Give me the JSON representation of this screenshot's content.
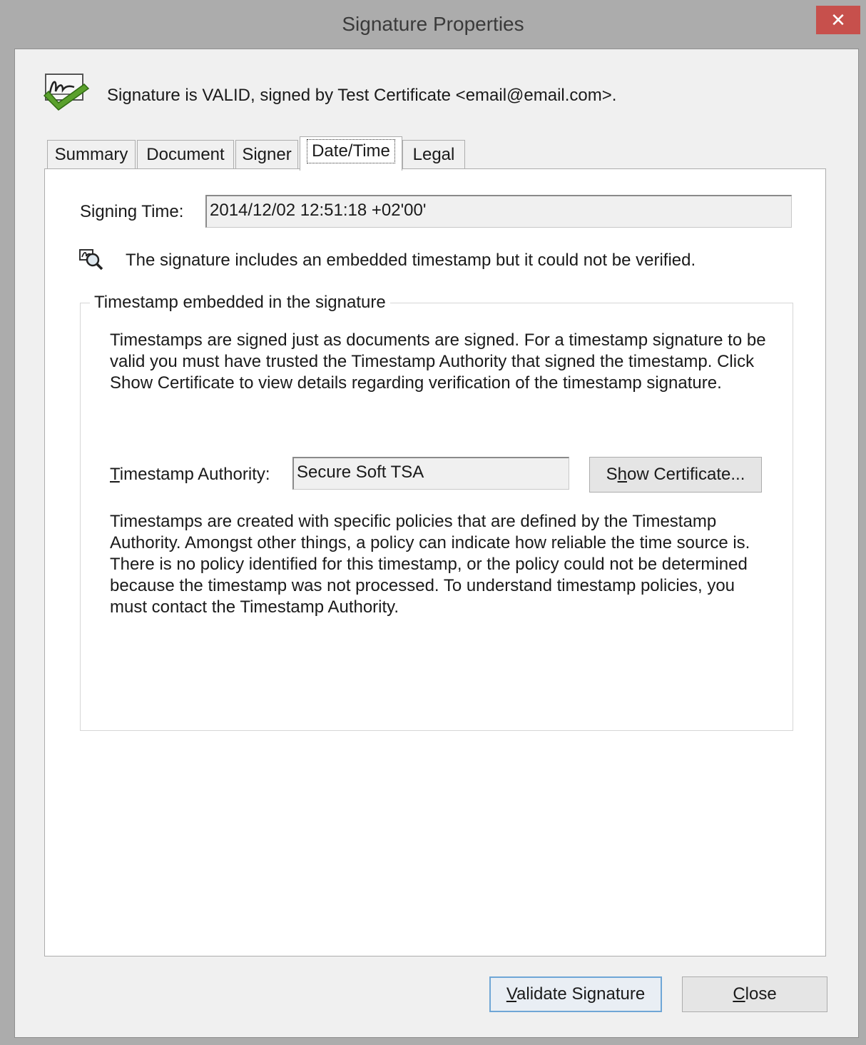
{
  "window": {
    "title": "Signature Properties",
    "close_glyph": "✕"
  },
  "status": {
    "icon": "signature-valid-icon",
    "text": "Signature is VALID, signed by Test Certificate <email@email.com>."
  },
  "tabs": [
    {
      "label": "Summary",
      "active": false
    },
    {
      "label": "Document",
      "active": false
    },
    {
      "label": "Signer",
      "active": false
    },
    {
      "label": "Date/Time",
      "active": true
    },
    {
      "label": "Legal",
      "active": false
    }
  ],
  "datetime": {
    "signing_time_label": "Signing Time:",
    "signing_time_value": "2014/12/02 12:51:18 +02'00'",
    "timestamp_warning_icon": "timestamp-warning-icon",
    "timestamp_warning": "The signature includes an embedded timestamp but it could not be verified.",
    "group_title": "Timestamp embedded in the signature",
    "intro_text": "Timestamps are signed just as documents are signed. For a timestamp signature to be valid you must have trusted the Timestamp Authority that signed the timestamp. Click Show Certificate to view details regarding verification of the timestamp signature.",
    "authority_label_mnemonic": "T",
    "authority_label_rest": "imestamp Authority:",
    "authority_value": "Secure Soft TSA",
    "show_cert_pre": "S",
    "show_cert_mnemonic": "h",
    "show_cert_post": "ow Certificate...",
    "policy_text": "Timestamps are created with specific policies that are defined by the Timestamp Authority. Amongst other things, a policy can indicate how reliable the time source is. There is no policy identified for this timestamp, or the policy could not be determined because the timestamp was not processed. To understand timestamp policies, you must contact the Timestamp Authority."
  },
  "footer": {
    "validate_mnemonic": "V",
    "validate_rest": "alidate Signature",
    "close_mnemonic": "C",
    "close_rest": "lose"
  },
  "colors": {
    "titlebar": "#acacac",
    "close_button": "#c7504c",
    "client_bg": "#f0f0f0",
    "panel_bg": "#ffffff",
    "check_green": "#5aa02c",
    "default_button_border": "#6fa6d6"
  }
}
